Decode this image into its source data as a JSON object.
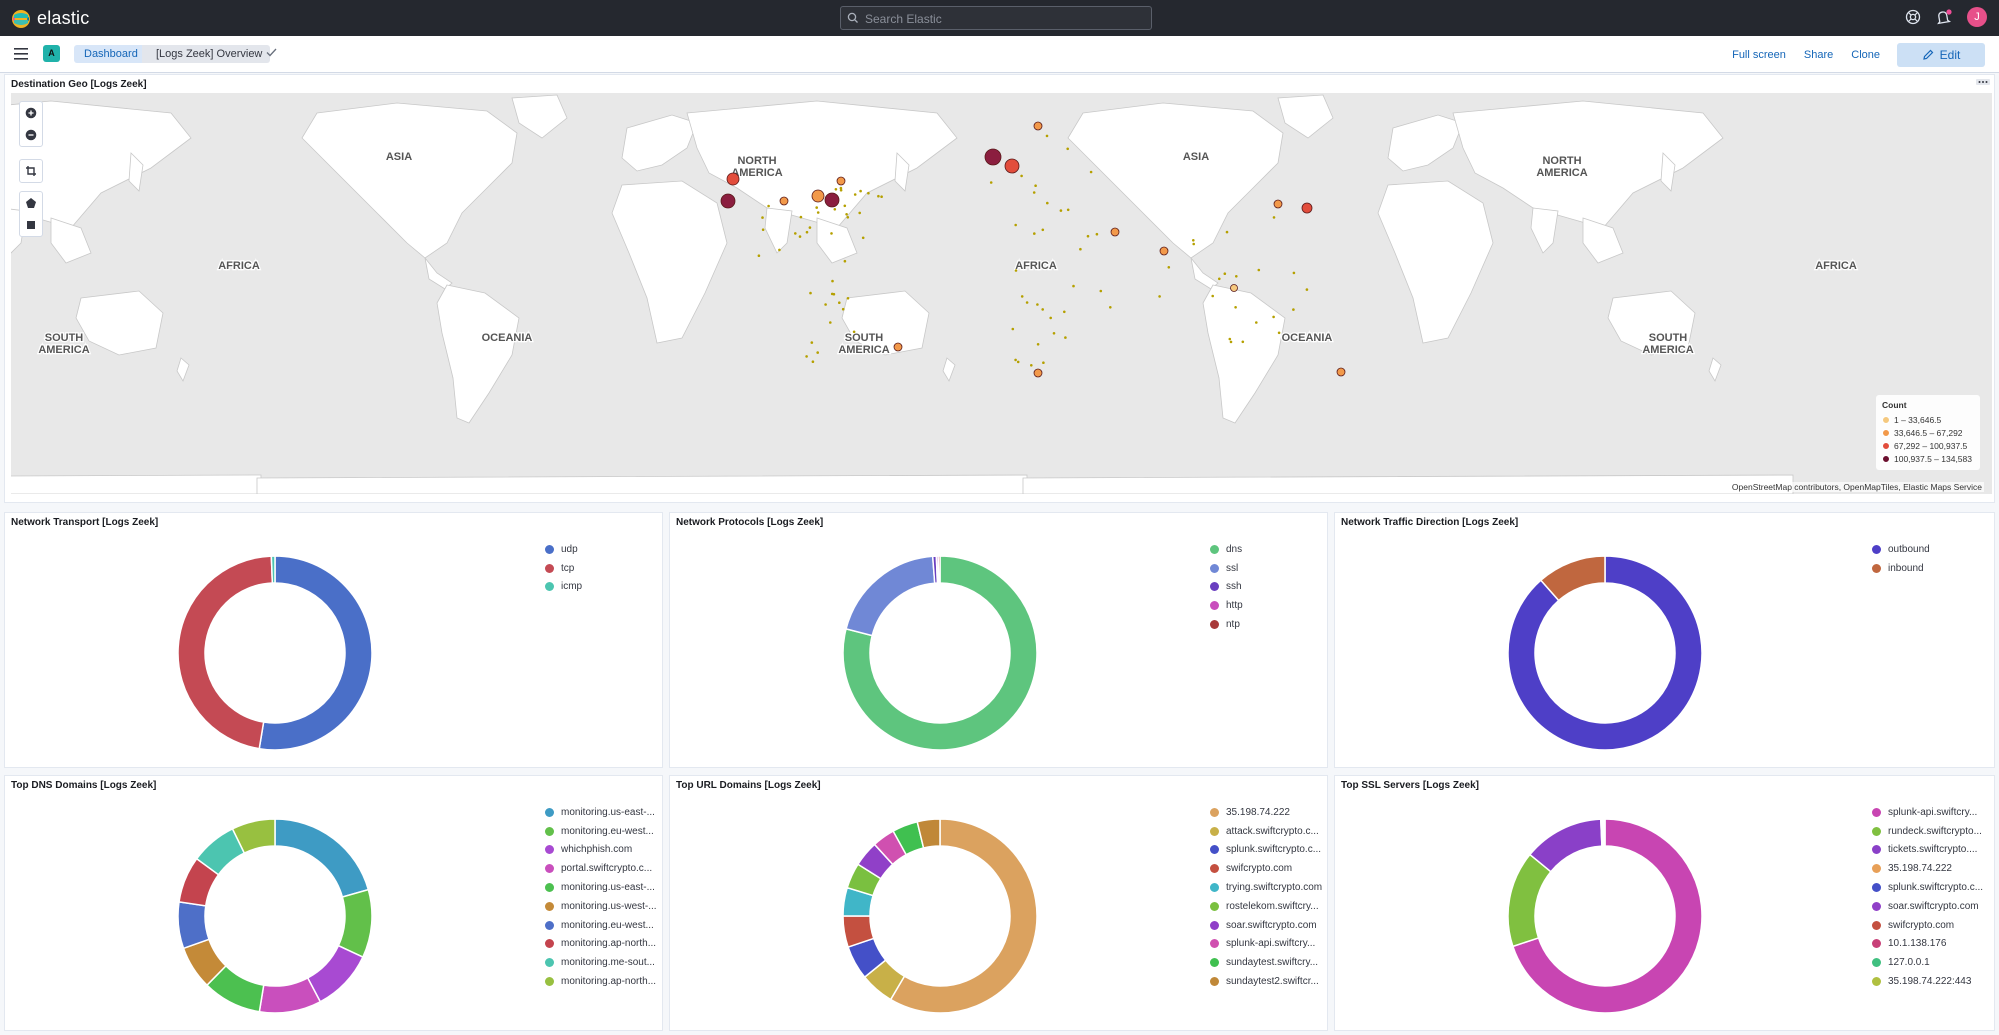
{
  "app": {
    "brand": "elastic",
    "search_placeholder": "Search Elastic",
    "avatar_initial": "J",
    "space_initial": "A"
  },
  "breadcrumbs": [
    "Dashboard",
    "[Logs Zeek] Overview"
  ],
  "actions": {
    "fullscreen": "Full screen",
    "share": "Share",
    "clone": "Clone",
    "edit": "Edit"
  },
  "map": {
    "title": "Destination Geo [Logs Zeek]",
    "labels": [
      {
        "t": "ASIA"
      },
      {
        "t": "AFRICA"
      },
      {
        "t": "SOUTH\nAMERICA"
      },
      {
        "t": "OCEANIA"
      },
      {
        "t": "NORTH\nAMERICA"
      },
      {
        "t": "ASIA"
      },
      {
        "t": "AFRICA"
      },
      {
        "t": "SOUTH\nAMERICA"
      },
      {
        "t": "OCEANIA"
      },
      {
        "t": "NORTH\nAMERICA"
      },
      {
        "t": "AFRICA"
      },
      {
        "t": "SOUTH\nAMERICA"
      }
    ],
    "legend_title": "Count",
    "legend": [
      {
        "label": "1 – 33,646.5",
        "color": "#f5c97f"
      },
      {
        "label": "33,646.5 – 67,292",
        "color": "#f2994a"
      },
      {
        "label": "67,292 – 100,937.5",
        "color": "#e24d3c"
      },
      {
        "label": "100,937.5 – 134,583",
        "color": "#6b0f2e"
      }
    ],
    "attribution": "OpenStreetMap contributors, OpenMapTiles, Elastic Maps Service"
  },
  "panels": [
    {
      "title": "Network Transport [Logs Zeek]",
      "slices": [
        {
          "label": "udp",
          "value": 52.6,
          "color": "#4a6fc8"
        },
        {
          "label": "tcp",
          "value": 46.8,
          "color": "#c44a54"
        },
        {
          "label": "icmp",
          "value": 0.6,
          "color": "#4cc5b0"
        }
      ]
    },
    {
      "title": "Network Protocols [Logs Zeek]",
      "slices": [
        {
          "label": "dns",
          "value": 79.0,
          "color": "#5ec57e"
        },
        {
          "label": "ssl",
          "value": 19.8,
          "color": "#7088d6"
        },
        {
          "label": "ssh",
          "value": 0.6,
          "color": "#6a3fc0"
        },
        {
          "label": "http",
          "value": 0.3,
          "color": "#c94fbd"
        },
        {
          "label": "ntp",
          "value": 0.3,
          "color": "#a83a3a"
        }
      ]
    },
    {
      "title": "Network Traffic Direction [Logs Zeek]",
      "slices": [
        {
          "label": "outbound",
          "value": 88.5,
          "color": "#4e3fc7"
        },
        {
          "label": "inbound",
          "value": 11.5,
          "color": "#c0673f"
        }
      ]
    },
    {
      "title": "Top DNS Domains [Logs Zeek]",
      "slices": [
        {
          "label": "monitoring.us-east-...",
          "value": 20,
          "color": "#3e9bc4"
        },
        {
          "label": "monitoring.eu-west...",
          "value": 11,
          "color": "#62c04a"
        },
        {
          "label": "whichphish.com",
          "value": 10,
          "color": "#a84ad2"
        },
        {
          "label": "portal.swiftcrypto.c...",
          "value": 10,
          "color": "#c94fbd"
        },
        {
          "label": "monitoring.us-east-...",
          "value": 9.5,
          "color": "#4cc050"
        },
        {
          "label": "monitoring.us-west-...",
          "value": 7,
          "color": "#c48a38"
        },
        {
          "label": "monitoring.eu-west...",
          "value": 7.5,
          "color": "#4e6fc8"
        },
        {
          "label": "monitoring.ap-north...",
          "value": 7.5,
          "color": "#c4444e"
        },
        {
          "label": "monitoring.me-sout...",
          "value": 7.5,
          "color": "#4cc5b0"
        },
        {
          "label": "monitoring.ap-north...",
          "value": 7,
          "color": "#98c040"
        }
      ]
    },
    {
      "title": "Top URL Domains [Logs Zeek]",
      "slices": [
        {
          "label": "35.198.74.222",
          "value": 62,
          "color": "#dba25f"
        },
        {
          "label": "attack.swiftcrypto.c...",
          "value": 6,
          "color": "#c8b048"
        },
        {
          "label": "splunk.swiftcrypto.c...",
          "value": 6,
          "color": "#4450c8"
        },
        {
          "label": "swifcrypto.com",
          "value": 5.5,
          "color": "#c45040"
        },
        {
          "label": "trying.swiftcrypto.com",
          "value": 5,
          "color": "#40b6c8"
        },
        {
          "label": "rostelekom.swiftcry...",
          "value": 4.5,
          "color": "#7ac040"
        },
        {
          "label": "soar.swiftcrypto.com",
          "value": 4.5,
          "color": "#9040c8"
        },
        {
          "label": "splunk-api.swiftcry...",
          "value": 4,
          "color": "#d050b0"
        },
        {
          "label": "sundaytest.swiftcry...",
          "value": 4.5,
          "color": "#40c050"
        },
        {
          "label": "sundaytest2.swiftcr...",
          "value": 4,
          "color": "#c08838"
        }
      ]
    },
    {
      "title": "Top SSL Servers [Logs Zeek]",
      "slices": [
        {
          "label": "splunk-api.swiftcry...",
          "value": 70,
          "color": "#c845b2"
        },
        {
          "label": "rundeck.swiftcrypto...",
          "value": 16,
          "color": "#80c040"
        },
        {
          "label": "tickets.swiftcrypto....",
          "value": 13.4,
          "color": "#8a40c8"
        },
        {
          "label": "35.198.74.222",
          "value": 0.1,
          "color": "#e8a058"
        },
        {
          "label": "splunk.swiftcrypto.c...",
          "value": 0.1,
          "color": "#4450c8"
        },
        {
          "label": "soar.swiftcrypto.com",
          "value": 0.1,
          "color": "#9040c8"
        },
        {
          "label": "swifcrypto.com",
          "value": 0.1,
          "color": "#c45040"
        },
        {
          "label": "10.1.138.176",
          "value": 0.1,
          "color": "#c84078"
        },
        {
          "label": "127.0.0.1",
          "value": 0.1,
          "color": "#40c080"
        },
        {
          "label": "35.198.74.222:443",
          "value": 0.1,
          "color": "#b0c040"
        }
      ]
    }
  ]
}
